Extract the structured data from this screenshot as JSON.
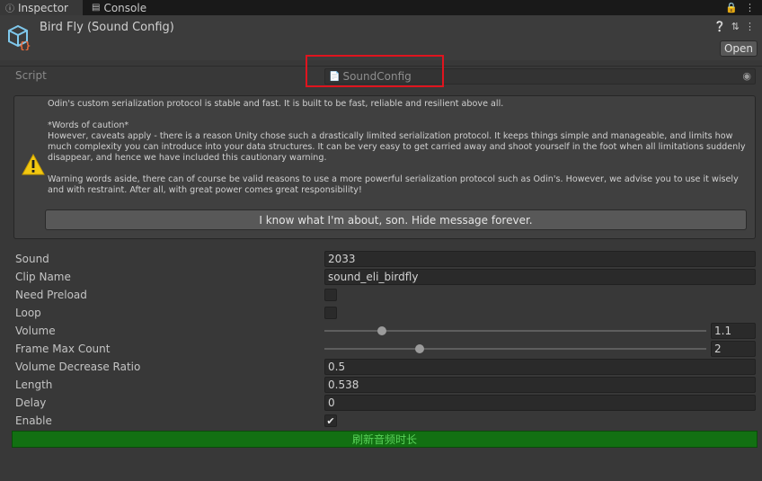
{
  "tabs": [
    {
      "label": "Inspector",
      "icon": "info-icon",
      "active": true
    },
    {
      "label": "Console",
      "icon": "console-icon",
      "active": false
    }
  ],
  "header": {
    "title": "Bird Fly (Sound Config)",
    "open_label": "Open"
  },
  "script": {
    "label": "Script",
    "value": "SoundConfig"
  },
  "warning": {
    "text": "Odin's custom serialization protocol is stable and fast. It is built to be fast, reliable and resilient above all.\n\n*Words of caution*\nHowever, caveats apply - there is a reason Unity chose such a drastically limited serialization protocol. It keeps things simple and manageable, and limits how much complexity you can introduce into your data structures. It can be very easy to get carried away and shoot yourself in the foot when all limitations suddenly disappear, and hence we have included this cautionary warning.\n\nWarning words aside, there can of course be valid reasons to use a more powerful serialization protocol such as Odin's. However, we advise you to use it wisely and with restraint. After all, with great power comes great responsibility!",
    "button_label": "I know what I'm about, son. Hide message forever."
  },
  "fields": {
    "sound": {
      "label": "Sound",
      "value": "2033"
    },
    "clip_name": {
      "label": "Clip Name",
      "value": "sound_eli_birdfly"
    },
    "need_preload": {
      "label": "Need Preload",
      "checked": false
    },
    "loop": {
      "label": "Loop",
      "checked": false
    },
    "volume": {
      "label": "Volume",
      "value": "1.1",
      "fraction": 0.15
    },
    "frame_max_count": {
      "label": "Frame Max Count",
      "value": "2",
      "fraction": 0.25
    },
    "volume_decrease_ratio": {
      "label": "Volume Decrease Ratio",
      "value": "0.5"
    },
    "length": {
      "label": "Length",
      "value": "0.538"
    },
    "delay": {
      "label": "Delay",
      "value": "0"
    },
    "enable": {
      "label": "Enable",
      "checked": true,
      "mark": "✔"
    }
  },
  "refresh_button": {
    "label": "刷新音频时长"
  },
  "colors": {
    "accent_green": "#127012",
    "highlight_red": "#e0141e",
    "warning_yellow": "#f2c811"
  }
}
